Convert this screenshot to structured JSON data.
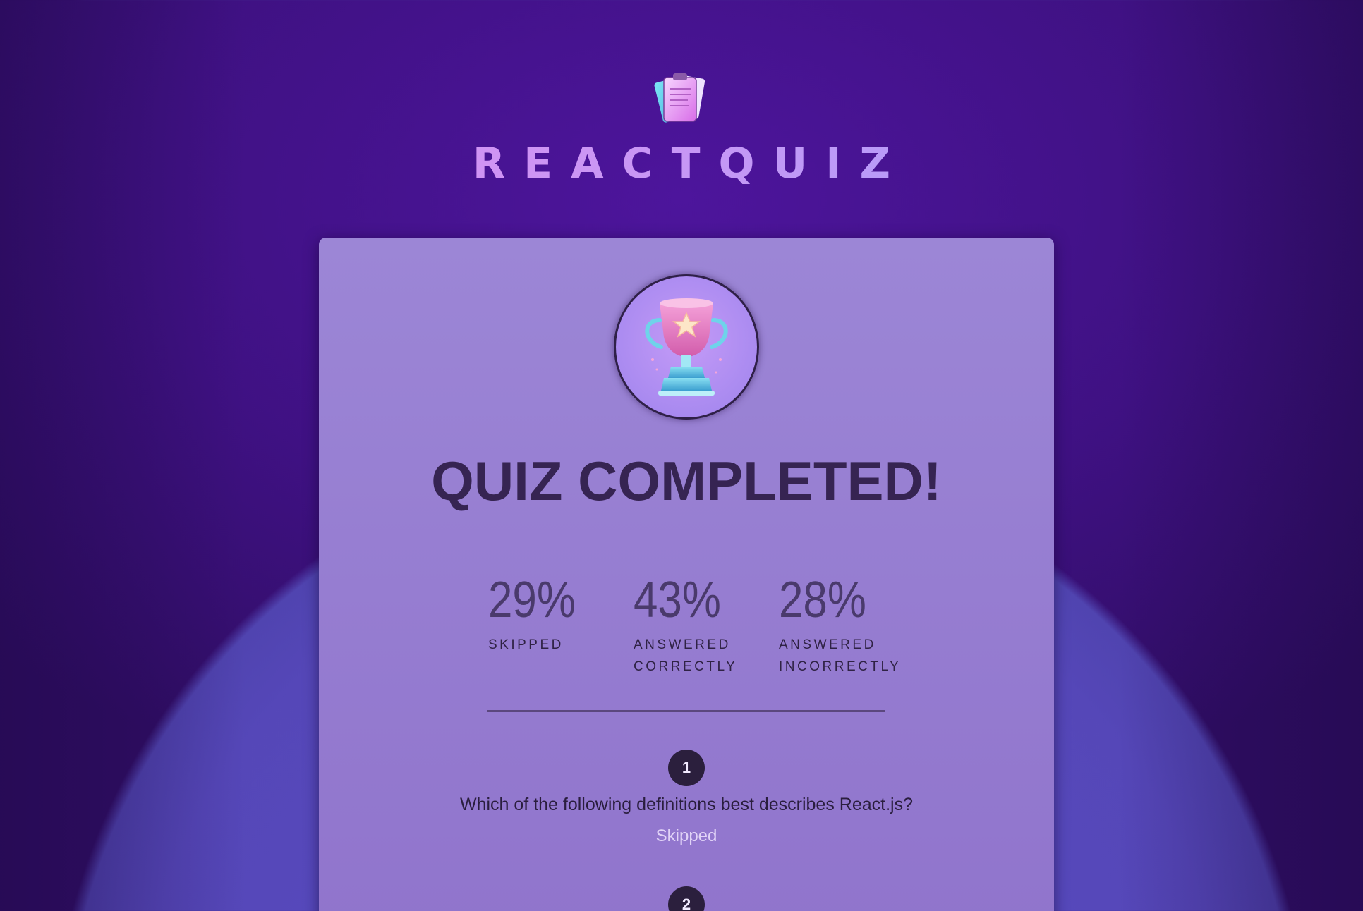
{
  "header": {
    "logo_icon": "quiz-clipboard-icon",
    "title": "REACTQUIZ"
  },
  "summary": {
    "trophy_icon": "trophy-icon",
    "title": "QUIZ COMPLETED!",
    "stats": [
      {
        "value": "29%",
        "label": "SKIPPED"
      },
      {
        "value": "43%",
        "label": "ANSWERED CORRECTLY"
      },
      {
        "value": "28%",
        "label": "ANSWERED INCORRECTLY"
      }
    ],
    "answers": [
      {
        "number": "1",
        "question": "Which of the following definitions best describes React.js?",
        "status": "Skipped"
      },
      {
        "number": "2"
      }
    ]
  },
  "colors": {
    "background": "#3f1183",
    "card": "#9a82d4",
    "title_text": "#362452",
    "skipped_text": "#e1d3f7",
    "badge": "#2b1f3d"
  }
}
